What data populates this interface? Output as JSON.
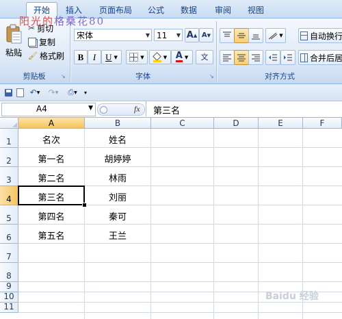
{
  "tabs": [
    "开始",
    "插入",
    "页面布局",
    "公式",
    "数据",
    "审阅",
    "视图"
  ],
  "overlay_text": {
    "part1": "阳光的",
    "part2": "格桑",
    "part3": "花80"
  },
  "clipboard": {
    "paste_label": "粘贴",
    "cut_label": "剪切",
    "copy_label": "复制",
    "format_painter_label": "格式刷",
    "group_label": "剪贴板"
  },
  "font": {
    "name": "宋体",
    "size": "11",
    "grow_label": "A",
    "shrink_label": "A",
    "bold": "B",
    "italic": "I",
    "underline": "U",
    "font_color_label": "A",
    "phonetic_label": "文",
    "group_label": "字体"
  },
  "alignment": {
    "wrap_label": "自动换行",
    "merge_label": "合并后居",
    "group_label": "对齐方式"
  },
  "formula_bar": {
    "name_box": "A4",
    "fx": "fx",
    "content": "第三名"
  },
  "columns": [
    "A",
    "B",
    "C",
    "D",
    "E",
    "F"
  ],
  "rows": [
    "1",
    "2",
    "3",
    "4",
    "5",
    "6",
    "7",
    "8",
    "9",
    "10",
    "11"
  ],
  "sheet": [
    [
      "名次",
      "姓名"
    ],
    [
      "第一名",
      "胡婷婷"
    ],
    [
      "第二名",
      "林雨"
    ],
    [
      "第三名",
      "刘丽"
    ],
    [
      "第四名",
      "秦可"
    ],
    [
      "第五名",
      "王兰"
    ]
  ],
  "active_cell": "A4",
  "watermark": "Baidu 经验",
  "colors": {
    "accent": "#15428b",
    "ribbon": "#dbe7f6",
    "selection": "#f6c35d"
  }
}
